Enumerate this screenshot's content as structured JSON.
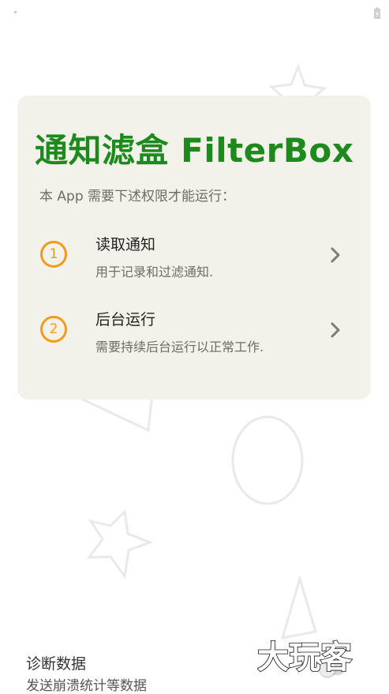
{
  "card": {
    "title": "通知滤盒 FilterBox",
    "subtitle": "本 App 需要下述权限才能运行：",
    "permissions": [
      {
        "number": "1",
        "title": "读取通知",
        "description": "用于记录和过滤通知."
      },
      {
        "number": "2",
        "title": "后台运行",
        "description": "需要持续后台运行以正常工作."
      }
    ]
  },
  "diagnostics": {
    "title": "诊断数据",
    "subtitle": "发送崩溃统计等数据",
    "toggle_on": false
  },
  "watermark": {
    "text": "大玩客"
  },
  "colors": {
    "title_green": "#1e8a1e",
    "step_orange": "#f29b16",
    "card_bg": "#f3f2ea"
  }
}
